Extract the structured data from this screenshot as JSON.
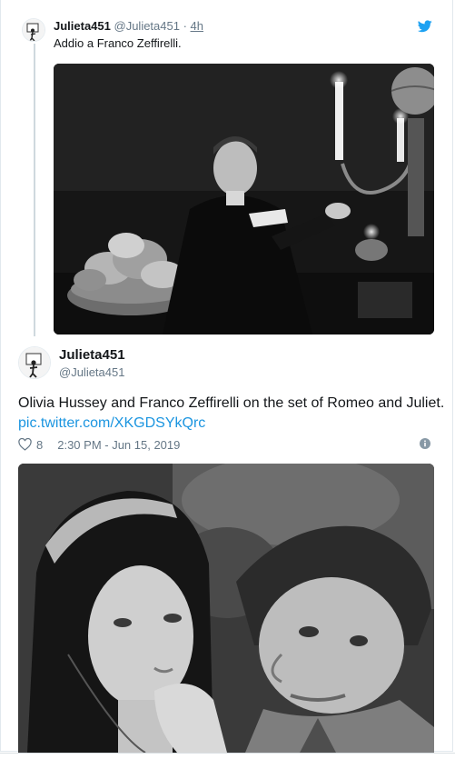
{
  "parent_tweet": {
    "name": "Julieta451",
    "handle": "@Julieta451",
    "separator": " · ",
    "time": "4h",
    "text": "Addio a Franco Zeffirelli."
  },
  "main_tweet": {
    "name": "Julieta451",
    "handle": "@Julieta451",
    "text": "Olivia Hussey and Franco Zeffirelli on the set of Romeo and Juliet.",
    "link": "pic.twitter.com/XKGDSYkQrc",
    "likes": "8",
    "timestamp": "2:30 PM - Jun 15, 2019"
  },
  "colors": {
    "link": "#1b95e0",
    "secondary_text": "#657786",
    "twitter_blue": "#1da1f2"
  }
}
